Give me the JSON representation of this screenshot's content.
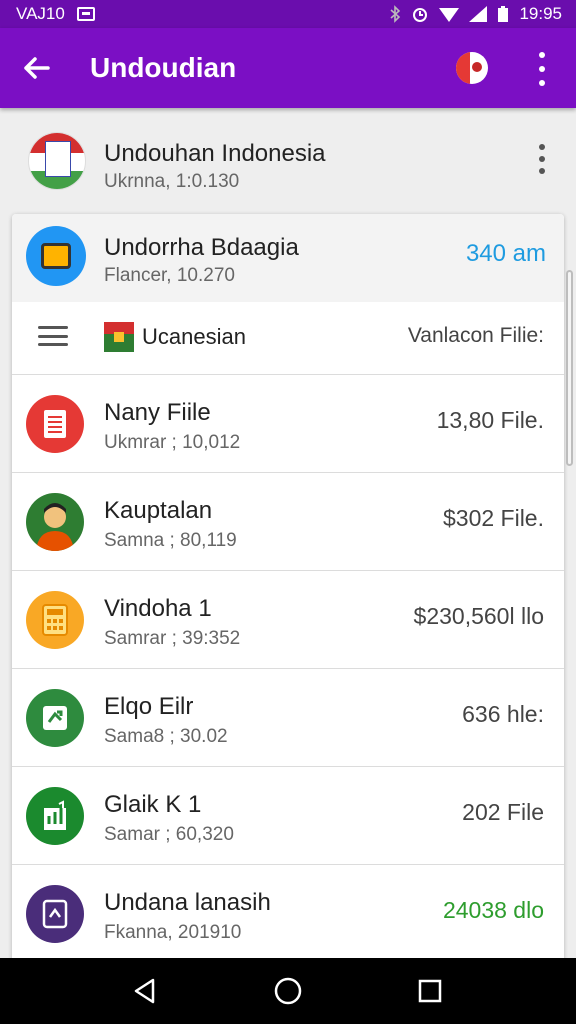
{
  "status": {
    "left_text": "VAJ10",
    "time": "19:95"
  },
  "appbar": {
    "title": "Undoudian"
  },
  "header_item": {
    "title": "Undouhan Indonesia",
    "subtitle": "Ukrnna, 1:0.130"
  },
  "card_top": {
    "title": "Undorrha Bdaagia",
    "subtitle": "Flancer, 10.270",
    "amount": "340 am",
    "amount_color": "#1e9be0"
  },
  "filter": {
    "label": "Ucanesian",
    "right_label": "Vanlacon Filie:"
  },
  "rows": [
    {
      "title": "Nany Fiile",
      "subtitle": "Ukmrar ; 10,012",
      "value": "13,80 File.",
      "icon": "document-icon",
      "icon_color": "#e53935",
      "value_color": "#444444"
    },
    {
      "title": "Kauptalan",
      "subtitle": "Samna ; 80,119",
      "value": "$302 File.",
      "icon": "person-avatar-icon",
      "icon_color": "#2e7d32",
      "value_color": "#444444"
    },
    {
      "title": "Vindoha 1",
      "subtitle": "Samrar ; 39:352",
      "value": "$230,560l llo",
      "icon": "calculator-icon",
      "icon_color": "#f9a825",
      "value_color": "#444444"
    },
    {
      "title": "Elqo Eilr",
      "subtitle": "Sama8 ; 30.02",
      "value": "636 hle:",
      "icon": "puzzle-icon",
      "icon_color": "#2e8b3e",
      "value_color": "#444444"
    },
    {
      "title": "Glaik K 1",
      "subtitle": "Samar ; 60,320",
      "value": "202 File",
      "icon": "chart-icon",
      "icon_color": "#1b8a2e",
      "value_color": "#444444"
    },
    {
      "title": "Undana lanasih",
      "subtitle": "Fkanna, 201910",
      "value": "24038 dlo",
      "icon": "frame-icon",
      "icon_color": "#4a2d7a",
      "value_color": "#2e9d2e"
    }
  ],
  "colors": {
    "statusbar": "#6a0dad",
    "appbar": "#7b0fc4"
  }
}
